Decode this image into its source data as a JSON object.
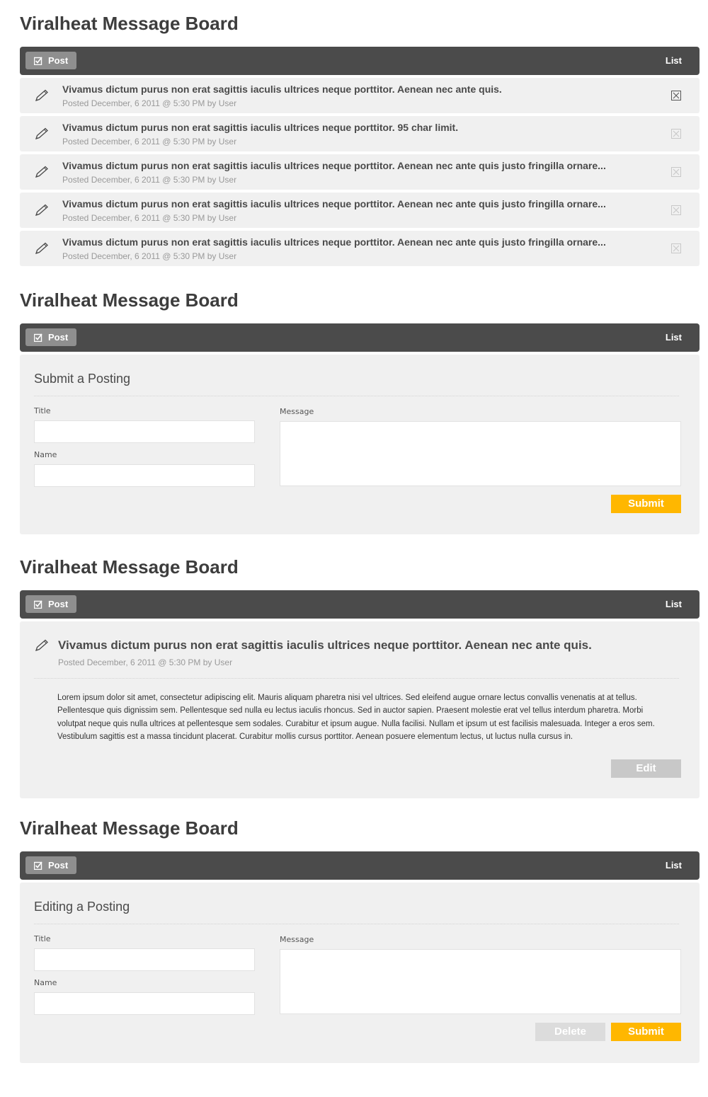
{
  "board_title": "Viralheat Message Board",
  "toolbar": {
    "post_label": "Post",
    "list_label": "List"
  },
  "list_view": {
    "rows": [
      {
        "title": "Vivamus dictum purus non erat sagittis iaculis ultrices neque porttitor. Aenean nec ante quis.",
        "meta": "Posted December, 6 2011 @ 5:30 PM by User"
      },
      {
        "title": "Vivamus dictum purus non erat sagittis iaculis ultrices neque porttitor. 95 char limit.",
        "meta": "Posted December, 6 2011 @ 5:30 PM by User"
      },
      {
        "title": "Vivamus dictum purus non erat sagittis iaculis ultrices neque porttitor. Aenean nec ante quis justo fringilla ornare...",
        "meta": "Posted December, 6 2011 @ 5:30 PM by User"
      },
      {
        "title": "Vivamus dictum purus non erat sagittis iaculis ultrices neque porttitor. Aenean nec ante quis justo fringilla ornare...",
        "meta": "Posted December, 6 2011 @ 5:30 PM by User"
      },
      {
        "title": "Vivamus dictum purus non erat sagittis iaculis ultrices neque porttitor. Aenean nec ante quis justo fringilla ornare...",
        "meta": "Posted December, 6 2011 @ 5:30 PM by User"
      }
    ]
  },
  "submit_view": {
    "heading": "Submit a Posting",
    "title_label": "Title",
    "name_label": "Name",
    "message_label": "Message",
    "title_value": "",
    "name_value": "",
    "message_value": "",
    "submit_label": "Submit"
  },
  "detail_view": {
    "title": "Vivamus dictum purus non erat sagittis iaculis ultrices neque porttitor. Aenean nec ante quis.",
    "meta": "Posted December, 6 2011 @ 5:30 PM by User",
    "body": "Lorem ipsum dolor sit amet, consectetur adipiscing elit. Mauris aliquam pharetra nisi vel ultrices. Sed eleifend augue ornare lectus convallis venenatis at at tellus. Pellentesque quis dignissim sem. Pellentesque sed nulla eu lectus iaculis rhoncus. Sed in auctor sapien. Praesent molestie erat vel tellus interdum pharetra. Morbi volutpat neque quis nulla ultrices at pellentesque sem sodales. Curabitur et ipsum augue. Nulla facilisi. Nullam et ipsum ut est facilisis malesuada. Integer a eros sem. Vestibulum sagittis est a massa tincidunt placerat. Curabitur mollis cursus porttitor. Aenean posuere elementum lectus, ut luctus nulla cursus in.",
    "edit_label": "Edit"
  },
  "edit_view": {
    "heading": "Editing a Posting",
    "title_label": "Title",
    "name_label": "Name",
    "message_label": "Message",
    "title_value": "",
    "name_value": "",
    "message_value": "",
    "delete_label": "Delete",
    "submit_label": "Submit"
  },
  "icons": {
    "post": "checkbox-icon",
    "row": "pencil-icon",
    "delete": "close-box-icon"
  },
  "colors": {
    "toolbar": "#4b4b4b",
    "accent": "#ffb700",
    "panel": "#f0f0f0"
  }
}
